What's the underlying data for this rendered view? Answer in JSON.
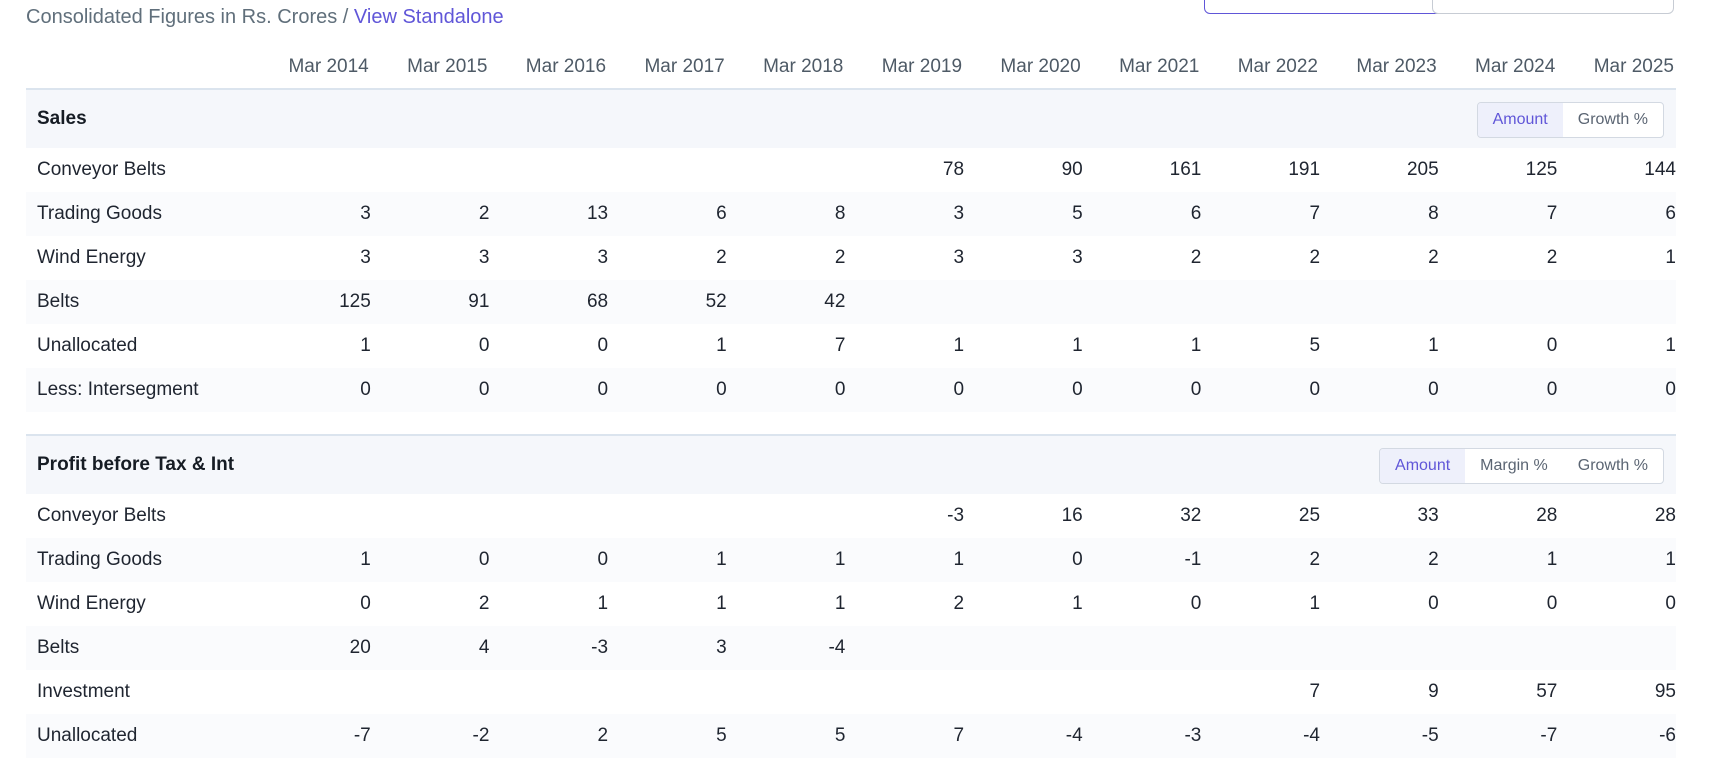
{
  "header": {
    "subtitle_prefix": "Consolidated Figures in Rs. Crores / ",
    "subtitle_link": "View Standalone"
  },
  "years": [
    "Mar 2014",
    "Mar 2015",
    "Mar 2016",
    "Mar 2017",
    "Mar 2018",
    "Mar 2019",
    "Mar 2020",
    "Mar 2021",
    "Mar 2022",
    "Mar 2023",
    "Mar 2024",
    "Mar 2025"
  ],
  "sections": [
    {
      "title": "Sales",
      "toggles": [
        "Amount",
        "Growth %"
      ],
      "active_toggle": "Amount",
      "rows": [
        {
          "label": "Conveyor Belts",
          "values": [
            "",
            "",
            "",
            "",
            "",
            "78",
            "90",
            "161",
            "191",
            "205",
            "125",
            "144"
          ]
        },
        {
          "label": "Trading Goods",
          "values": [
            "3",
            "2",
            "13",
            "6",
            "8",
            "3",
            "5",
            "6",
            "7",
            "8",
            "7",
            "6"
          ]
        },
        {
          "label": "Wind Energy",
          "values": [
            "3",
            "3",
            "3",
            "2",
            "2",
            "3",
            "3",
            "2",
            "2",
            "2",
            "2",
            "1"
          ]
        },
        {
          "label": "Belts",
          "values": [
            "125",
            "91",
            "68",
            "52",
            "42",
            "",
            "",
            "",
            "",
            "",
            "",
            ""
          ]
        },
        {
          "label": "Unallocated",
          "values": [
            "1",
            "0",
            "0",
            "1",
            "7",
            "1",
            "1",
            "1",
            "5",
            "1",
            "0",
            "1"
          ]
        },
        {
          "label": "Less: Intersegment",
          "values": [
            "0",
            "0",
            "0",
            "0",
            "0",
            "0",
            "0",
            "0",
            "0",
            "0",
            "0",
            "0"
          ]
        }
      ]
    },
    {
      "title": "Profit before Tax & Int",
      "toggles": [
        "Amount",
        "Margin %",
        "Growth %"
      ],
      "active_toggle": "Amount",
      "rows": [
        {
          "label": "Conveyor Belts",
          "values": [
            "",
            "",
            "",
            "",
            "",
            "-3",
            "16",
            "32",
            "25",
            "33",
            "28",
            "28"
          ]
        },
        {
          "label": "Trading Goods",
          "values": [
            "1",
            "0",
            "0",
            "1",
            "1",
            "1",
            "0",
            "-1",
            "2",
            "2",
            "1",
            "1"
          ]
        },
        {
          "label": "Wind Energy",
          "values": [
            "0",
            "2",
            "1",
            "1",
            "1",
            "2",
            "1",
            "0",
            "1",
            "0",
            "0",
            "0"
          ]
        },
        {
          "label": "Belts",
          "values": [
            "20",
            "4",
            "-3",
            "3",
            "-4",
            "",
            "",
            "",
            "",
            "",
            "",
            ""
          ]
        },
        {
          "label": "Investment",
          "values": [
            "",
            "",
            "",
            "",
            "",
            "",
            "",
            "",
            "7",
            "9",
            "57",
            "95"
          ]
        },
        {
          "label": "Unallocated",
          "values": [
            "-7",
            "-2",
            "2",
            "5",
            "5",
            "7",
            "-4",
            "-3",
            "-4",
            "-5",
            "-7",
            "-6"
          ]
        }
      ]
    }
  ]
}
